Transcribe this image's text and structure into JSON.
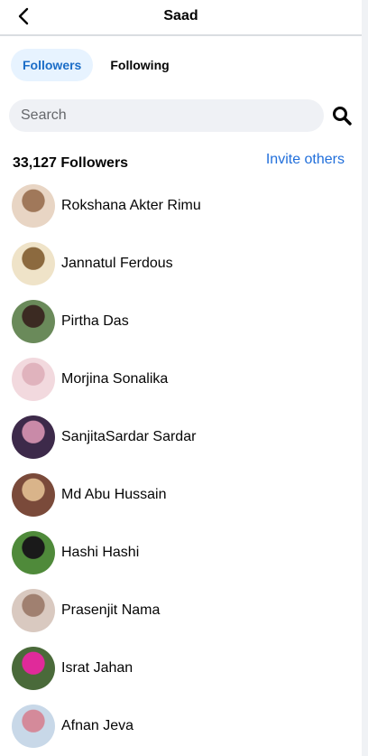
{
  "header": {
    "title": "Saad",
    "back_icon": "chevron-left-icon"
  },
  "tabs": [
    {
      "label": "Followers",
      "active": true
    },
    {
      "label": "Following",
      "active": false
    }
  ],
  "search": {
    "placeholder": "Search",
    "value": "",
    "icon": "search-icon"
  },
  "summary": {
    "count_label": "33,127 Followers",
    "invite_label": "Invite others"
  },
  "colors": {
    "accent": "#216fdb",
    "active_tab_bg": "#e7f3ff",
    "search_bg": "#eff1f5"
  },
  "followers": [
    {
      "name": "Rokshana Akter Rimu",
      "avatar_colors": [
        "#e8d5c4",
        "#a0785a"
      ]
    },
    {
      "name": "Jannatul Ferdous",
      "avatar_colors": [
        "#efe3c8",
        "#8c6a3f"
      ]
    },
    {
      "name": "Pirtha Das",
      "avatar_colors": [
        "#6a8a5a",
        "#3b2a22"
      ]
    },
    {
      "name": "Morjina Sonalika",
      "avatar_colors": [
        "#f2d9de",
        "#e0b3bd"
      ]
    },
    {
      "name": "SanjitaSardar Sardar",
      "avatar_colors": [
        "#3d2a4a",
        "#c98aa8"
      ]
    },
    {
      "name": "Md Abu Hussain",
      "avatar_colors": [
        "#7a4a3a",
        "#d9b48a"
      ]
    },
    {
      "name": "Hashi Hashi",
      "avatar_colors": [
        "#4f8a3a",
        "#1a1a1a"
      ]
    },
    {
      "name": "Prasenjit Nama",
      "avatar_colors": [
        "#d9c9c0",
        "#a08070"
      ]
    },
    {
      "name": "Israt Jahan",
      "avatar_colors": [
        "#4a6a3a",
        "#e02a9a"
      ]
    },
    {
      "name": "Afnan Jeva",
      "avatar_colors": [
        "#c8d8e8",
        "#d48a9a"
      ]
    }
  ]
}
